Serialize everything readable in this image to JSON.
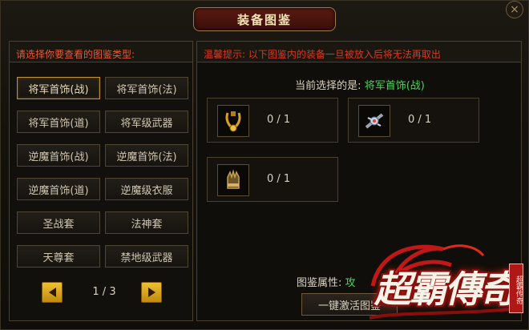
{
  "window": {
    "title": "装备图鉴",
    "close_glyph": "×"
  },
  "left": {
    "header": "请选择你要查看的图鉴类型:",
    "categories": [
      {
        "label": "将军首饰(战)",
        "active": true
      },
      {
        "label": "将军首饰(法)",
        "active": false
      },
      {
        "label": "将军首饰(道)",
        "active": false
      },
      {
        "label": "将军级武器",
        "active": false
      },
      {
        "label": "逆魔首饰(战)",
        "active": false
      },
      {
        "label": "逆魔首饰(法)",
        "active": false
      },
      {
        "label": "逆魔首饰(道)",
        "active": false
      },
      {
        "label": "逆魔级衣服",
        "active": false
      },
      {
        "label": "圣战套",
        "active": false
      },
      {
        "label": "法神套",
        "active": false
      },
      {
        "label": "天尊套",
        "active": false
      },
      {
        "label": "禁地级武器",
        "active": false
      }
    ],
    "pager": {
      "text": "1 / 3"
    }
  },
  "right": {
    "tip": "温馨提示: 以下图鉴内的装备一旦被放入后将无法再取出",
    "selected_label": "当前选择的是:",
    "selected_value": "将军首饰(战)",
    "items": [
      {
        "icon": "necklace-icon",
        "count": "0 / 1"
      },
      {
        "icon": "ring-icon",
        "count": "0 / 1"
      },
      {
        "icon": "bracelet-icon",
        "count": "0 / 1"
      }
    ],
    "attr_label": "图鉴属性:",
    "attr_value": "攻",
    "activate_label": "一键激活图鉴"
  },
  "logo": {
    "text": "超霸傳奇",
    "seal": "超霸传奇"
  },
  "colors": {
    "accent_red": "#d83a22",
    "green": "#4fd15a",
    "gold": "#c0923e"
  }
}
